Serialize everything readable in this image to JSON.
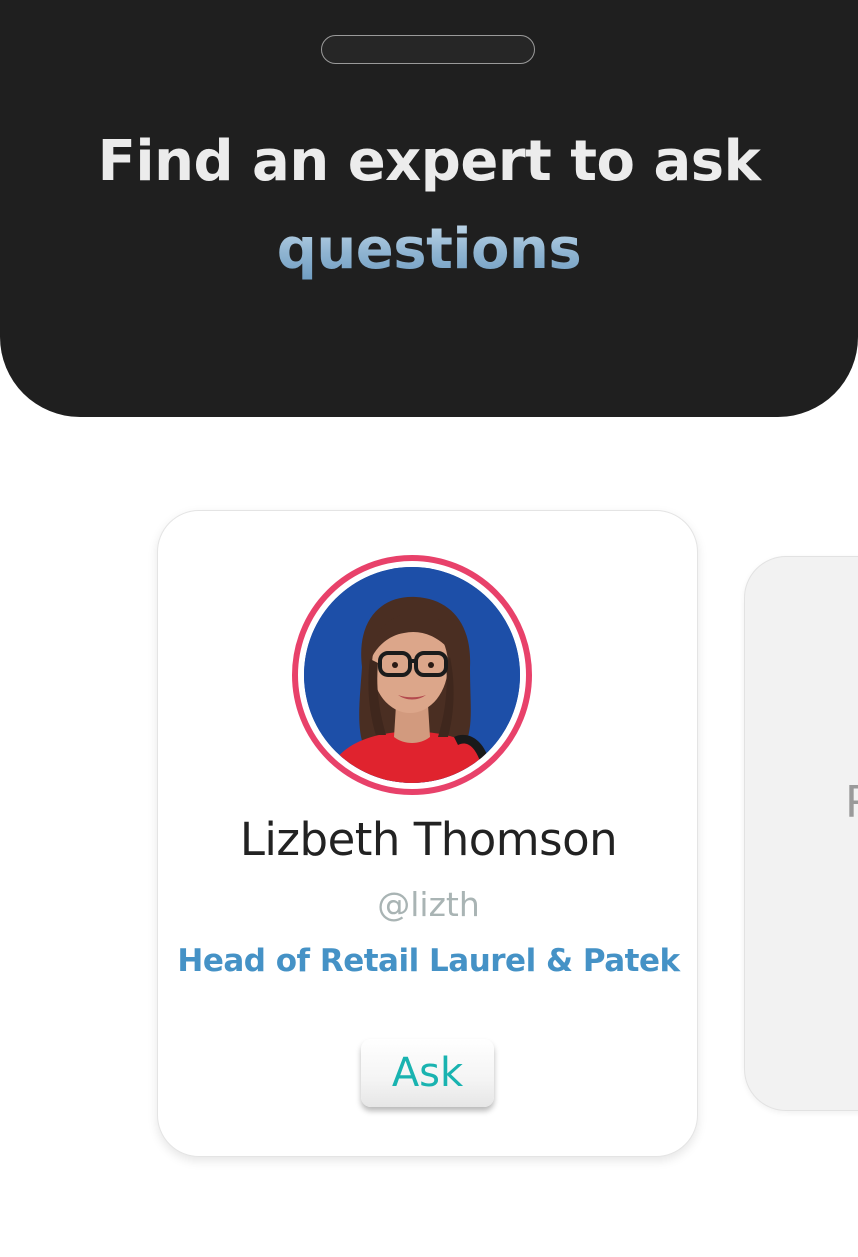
{
  "header": {
    "headline_line1": "Find an expert to ask",
    "headline_line2": "questions"
  },
  "expert_card": {
    "name": "Lizbeth Thomson",
    "handle": "@lizth",
    "title": "Head of Retail Laurel & Patek",
    "ask_label": "Ask"
  },
  "next_card": {
    "partial_letter": "P"
  },
  "colors": {
    "header_bg": "#1f1f1f",
    "accent_ring": "#e8416a",
    "title_blue": "#4592c6",
    "ask_teal": "#19b3b0"
  }
}
